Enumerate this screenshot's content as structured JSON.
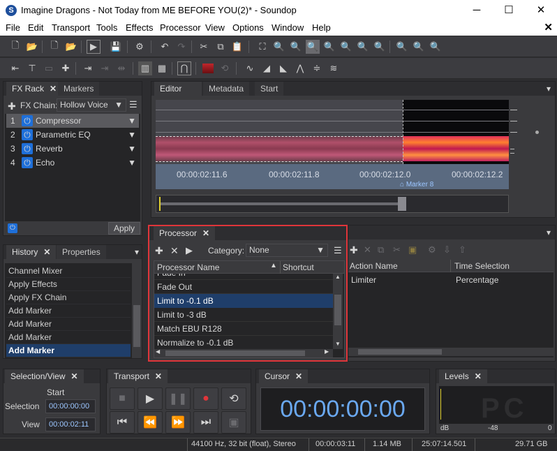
{
  "window": {
    "title": "Imagine Dragons - Not Today from ME BEFORE YOU(2)* - Soundop",
    "minimize": "─",
    "maximize": "☐",
    "close": "✕"
  },
  "menu": {
    "items": [
      "File",
      "Edit",
      "Transport",
      "Tools",
      "Effects",
      "Processor",
      "View",
      "Options",
      "Window",
      "Help"
    ],
    "close_doc": "✕"
  },
  "fx_rack": {
    "tabs": {
      "fx": "FX Rack",
      "markers": "Markers"
    },
    "chain_label": "FX Chain:",
    "chain_value": "Hollow Voice",
    "effects": [
      {
        "num": "1",
        "name": "Compressor"
      },
      {
        "num": "2",
        "name": "Parametric EQ"
      },
      {
        "num": "3",
        "name": "Reverb"
      },
      {
        "num": "4",
        "name": "Echo"
      }
    ],
    "apply": "Apply"
  },
  "editor": {
    "tabs": {
      "editor": "Editor",
      "metadata": "Metadata",
      "start": "Start"
    },
    "times": [
      "00:00:02:11.6",
      "00:00:02:11.8",
      "00:00:02:12.0",
      "00:00:02:12.2"
    ],
    "marker": "Marker 8"
  },
  "history": {
    "tabs": {
      "history": "History",
      "properties": "Properties"
    },
    "items": [
      "Channel Mixer",
      "Apply Effects",
      "Apply FX Chain",
      "Add Marker",
      "Add Marker",
      "Add Marker",
      "Add Marker"
    ]
  },
  "processor": {
    "tab": "Processor",
    "category_label": "Category:",
    "category_value": "None",
    "col_name": "Processor Name",
    "col_shortcut": "Shortcut",
    "items": [
      "Fade In",
      "Fade Out",
      "Limit to -0.1 dB",
      "Limit to -3 dB",
      "Match EBU R128",
      "Normalize to -0.1 dB"
    ],
    "col_action": "Action Name",
    "col_selection": "Time Selection",
    "action_row": {
      "name": "Limiter",
      "selection": "Percentage"
    }
  },
  "selection_view": {
    "tab": "Selection/View",
    "start_label": "Start",
    "selection_label": "Selection",
    "view_label": "View",
    "selection_value": "00:00:00:00",
    "view_value": "00:00:02:11"
  },
  "transport": {
    "tab": "Transport"
  },
  "cursor": {
    "tab": "Cursor",
    "time": "00:00:00:00"
  },
  "levels": {
    "tab": "Levels",
    "db": "dB",
    "mark": "-48",
    "zero": "0"
  },
  "status": {
    "format": "44100 Hz, 32 bit (float), Stereo",
    "duration": "00:00:03:11",
    "size": "1.14 MB",
    "time": "25:07:14.501",
    "free": "29.71 GB"
  }
}
